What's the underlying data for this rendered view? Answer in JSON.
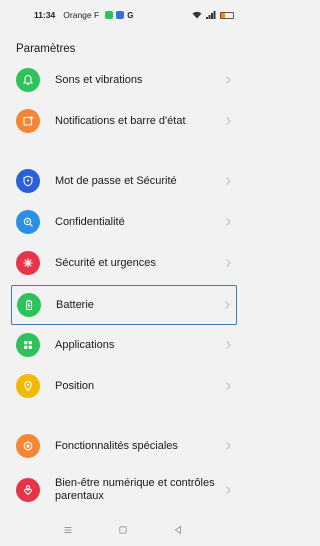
{
  "status_bar": {
    "time": "11:34",
    "carrier": "Orange F"
  },
  "page_title": "Paramètres",
  "items": [
    {
      "label": "Sons et vibrations",
      "icon": "bell-icon",
      "color": "#2ec25a"
    },
    {
      "label": "Notifications et barre d'état",
      "icon": "notification-icon",
      "color": "#f58634"
    },
    {
      "label": "Mot de passe et Sécurité",
      "icon": "shield-icon",
      "color": "#2a5fd9"
    },
    {
      "label": "Confidentialité",
      "icon": "privacy-icon",
      "color": "#2a8fe6"
    },
    {
      "label": "Sécurité et urgences",
      "icon": "emergency-icon",
      "color": "#e8344a"
    },
    {
      "label": "Batterie",
      "icon": "battery-icon",
      "color": "#2ec25a"
    },
    {
      "label": "Applications",
      "icon": "apps-icon",
      "color": "#2ec25a"
    },
    {
      "label": "Position",
      "icon": "location-icon",
      "color": "#f5b800"
    },
    {
      "label": "Fonctionnalités spéciales",
      "icon": "star-icon",
      "color": "#f58634"
    },
    {
      "label": "Bien-être numérique et contrôles parentaux",
      "icon": "wellbeing-icon",
      "color": "#e8344a"
    }
  ],
  "colors": {
    "highlight": "#4a72c4",
    "background": "#f2f2f2"
  }
}
